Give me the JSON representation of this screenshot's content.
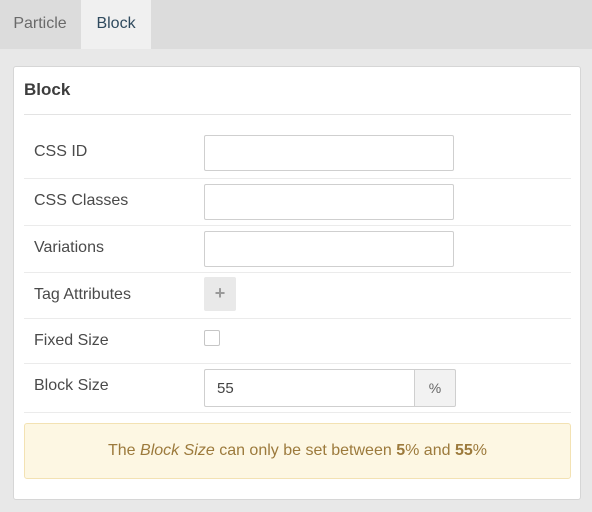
{
  "tabs": [
    {
      "label": "Particle",
      "active": false
    },
    {
      "label": "Block",
      "active": true
    }
  ],
  "panel": {
    "title": "Block",
    "fields": {
      "css_id": {
        "label": "CSS ID",
        "value": "",
        "placeholder": ""
      },
      "css_classes": {
        "label": "CSS Classes",
        "value": "",
        "placeholder": ""
      },
      "variations": {
        "label": "Variations",
        "value": "",
        "placeholder": ""
      },
      "tag_attributes": {
        "label": "Tag Attributes",
        "button": "+"
      },
      "fixed_size": {
        "label": "Fixed Size",
        "checked": false
      },
      "block_size": {
        "label": "Block Size",
        "value": "55",
        "unit": "%"
      }
    },
    "alert": {
      "prefix": "The",
      "subject": "Block Size",
      "middle": "can only be set between",
      "min": "5",
      "and": "and",
      "max": "55",
      "unit": "%"
    }
  },
  "colors": {
    "accent": "#2f4a5e",
    "alert_bg": "#fdf7e3",
    "alert_text": "#9c7a3c"
  }
}
